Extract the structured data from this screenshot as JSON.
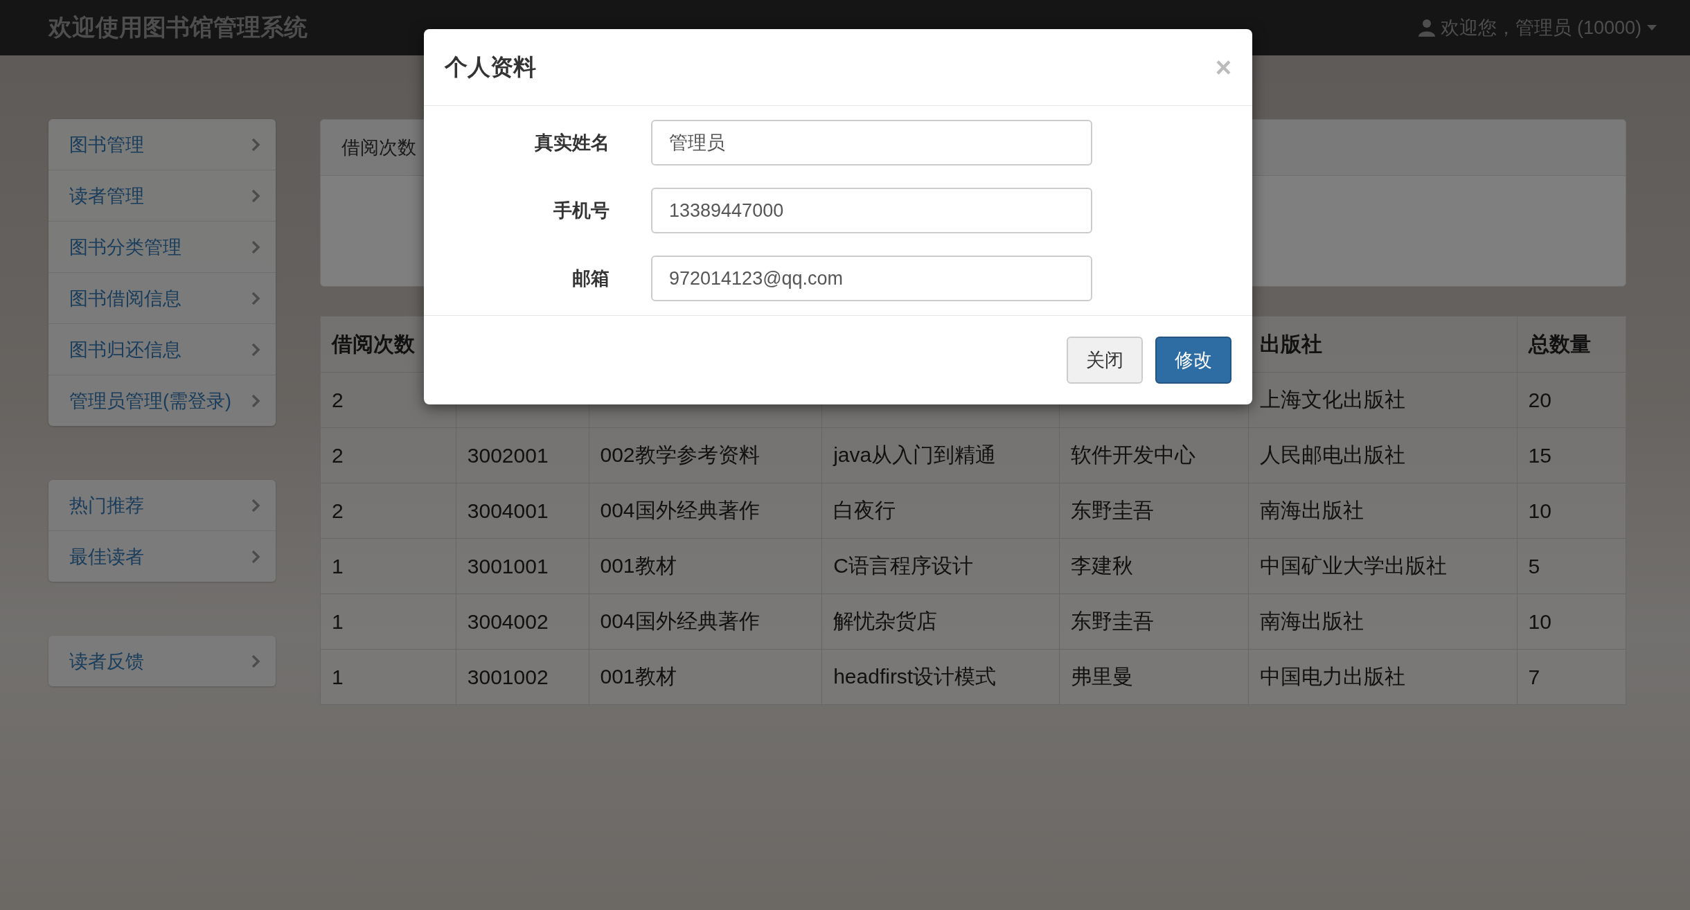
{
  "navbar": {
    "brand": "欢迎使用图书馆管理系统",
    "user": "欢迎您，管理员 (10000)"
  },
  "sidebar": {
    "groups": [
      [
        "图书管理",
        "读者管理",
        "图书分类管理",
        "图书借阅信息",
        "图书归还信息",
        "管理员管理(需登录)"
      ],
      [
        "热门推荐",
        "最佳读者"
      ],
      [
        "读者反馈"
      ]
    ]
  },
  "panel": {
    "heading": "借阅次数"
  },
  "table": {
    "columns": [
      "借阅次数",
      null,
      null,
      null,
      null,
      "出版社",
      "总数量"
    ],
    "rows": [
      [
        "2",
        null,
        null,
        null,
        null,
        "上海文化出版社",
        "20"
      ],
      [
        "2",
        "3002001",
        "002教学参考资料",
        "java从入门到精通",
        "软件开发中心",
        "人民邮电出版社",
        "15"
      ],
      [
        "2",
        "3004001",
        "004国外经典著作",
        "白夜行",
        "东野圭吾",
        "南海出版社",
        "10"
      ],
      [
        "1",
        "3001001",
        "001教材",
        "C语言程序设计",
        "李建秋",
        "中国矿业大学出版社",
        "5"
      ],
      [
        "1",
        "3004002",
        "004国外经典著作",
        "解忧杂货店",
        "东野圭吾",
        "南海出版社",
        "10"
      ],
      [
        "1",
        "3001002",
        "001教材",
        "headfirst设计模式",
        "弗里曼",
        "中国电力出版社",
        "7"
      ]
    ]
  },
  "modal": {
    "title": "个人资料",
    "close": "×",
    "fields": [
      {
        "label": "真实姓名",
        "value": "管理员"
      },
      {
        "label": "手机号",
        "value": "13389447000"
      },
      {
        "label": "邮箱",
        "value": "972014123@qq.com"
      }
    ],
    "buttons": [
      {
        "label": "关闭",
        "kind": "default"
      },
      {
        "label": "修改",
        "kind": "primary"
      }
    ]
  }
}
